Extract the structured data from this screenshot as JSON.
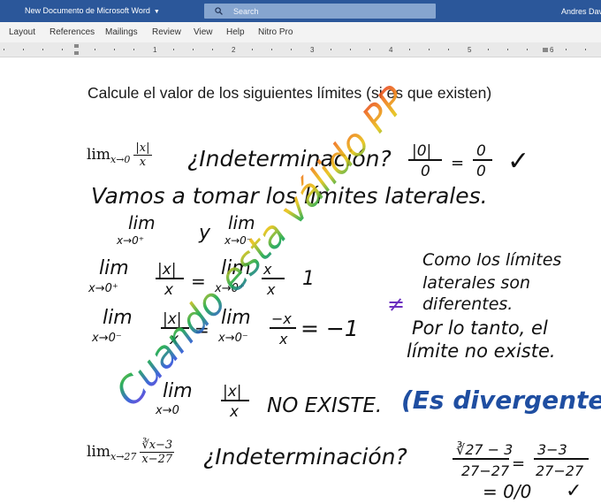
{
  "window": {
    "doc_title": "New Documento de Microsoft Word",
    "search_placeholder": "Search",
    "user": "Andres Dav"
  },
  "ribbon": {
    "tabs": [
      "Layout",
      "References",
      "Mailings",
      "Review",
      "View",
      "Help",
      "Nitro Pro"
    ]
  },
  "ruler": {
    "labels": [
      "1",
      "2",
      "3",
      "4",
      "5",
      "6"
    ]
  },
  "document": {
    "heading": "Calcule el valor de los siguientes límites (si es que existen)",
    "eq1": {
      "lim": "lim",
      "sub": "x→0",
      "num": "|x|",
      "den": "x"
    },
    "eq2": {
      "lim": "lim",
      "sub": "x→27",
      "num": "∛x−3",
      "den": "x−27"
    }
  },
  "handwriting": {
    "q1": "¿Indeterminación?",
    "f1_num": "|0|",
    "f1_den": "0",
    "f1_eq": "=",
    "f1_res_num": "0",
    "f1_res_den": "0",
    "check": "✓",
    "line2": "Vamos a tomar los límites laterales.",
    "lim_word": "lim",
    "y": "y",
    "sub_plus": "x→0⁺",
    "sub_minus": "x→0⁻",
    "abs_num": "|x|",
    "x_den": "x",
    "eq_sign": "=",
    "neg_x": "−x",
    "res1": "1",
    "res_neg1": "= −1",
    "neq": "≠",
    "note1": "Como los límites",
    "note2": "laterales son",
    "note3": "diferentes.",
    "note4": "Por lo tanto, el",
    "note5": "límite no existe.",
    "sub_zero": "x→0",
    "no_existe": "NO EXISTE.",
    "divergent": "(Es divergente)",
    "q2": "¿Indeterminación?",
    "f2_num": "∛27 − 3",
    "f2_den": "27−27",
    "f2_eq": "=",
    "f2_r_num": "3−3",
    "f2_r_den": "27−27",
    "f2_final": "= 0/0",
    "rainbow": "Cuando esta válido PP"
  },
  "colors": {
    "titlebar": "#2b579a",
    "ribbon": "#f3f3f3",
    "ink_black": "#111111",
    "ink_blue": "#1f4ea1"
  }
}
